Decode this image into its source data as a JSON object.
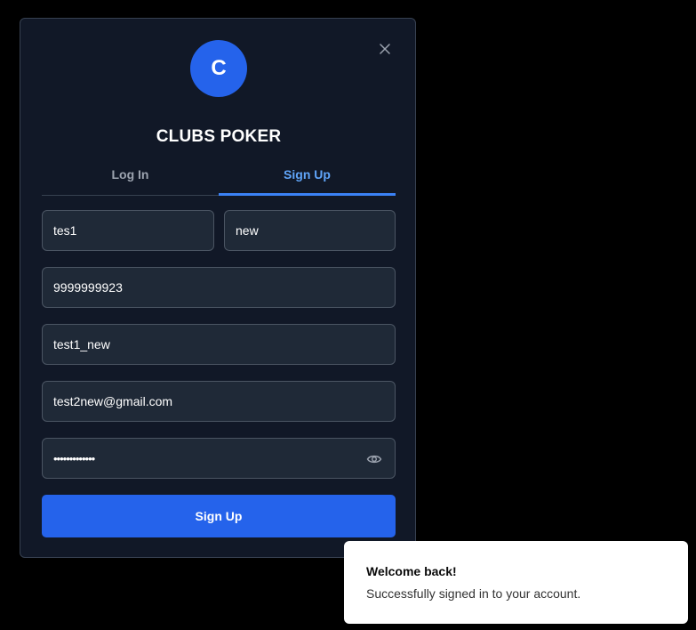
{
  "modal": {
    "avatar_letter": "C",
    "title": "CLUBS POKER",
    "close_icon": "close-icon",
    "tabs": [
      {
        "label": "Log In",
        "active": false
      },
      {
        "label": "Sign Up",
        "active": true
      }
    ],
    "form": {
      "first_name": "tes1",
      "last_name": "new",
      "phone": "9999999923",
      "username": "test1_new",
      "email": "test2new@gmail.com",
      "password_masked": "•••••••••••••",
      "password_toggle_icon": "eye-icon"
    },
    "submit_label": "Sign Up"
  },
  "toast": {
    "title": "Welcome back!",
    "description": "Successfully signed in to your account."
  },
  "colors": {
    "background": "#000000",
    "modal_bg": "#111827",
    "input_bg": "#1f2937",
    "accent": "#2563eb",
    "tab_active": "#60a5fa"
  }
}
